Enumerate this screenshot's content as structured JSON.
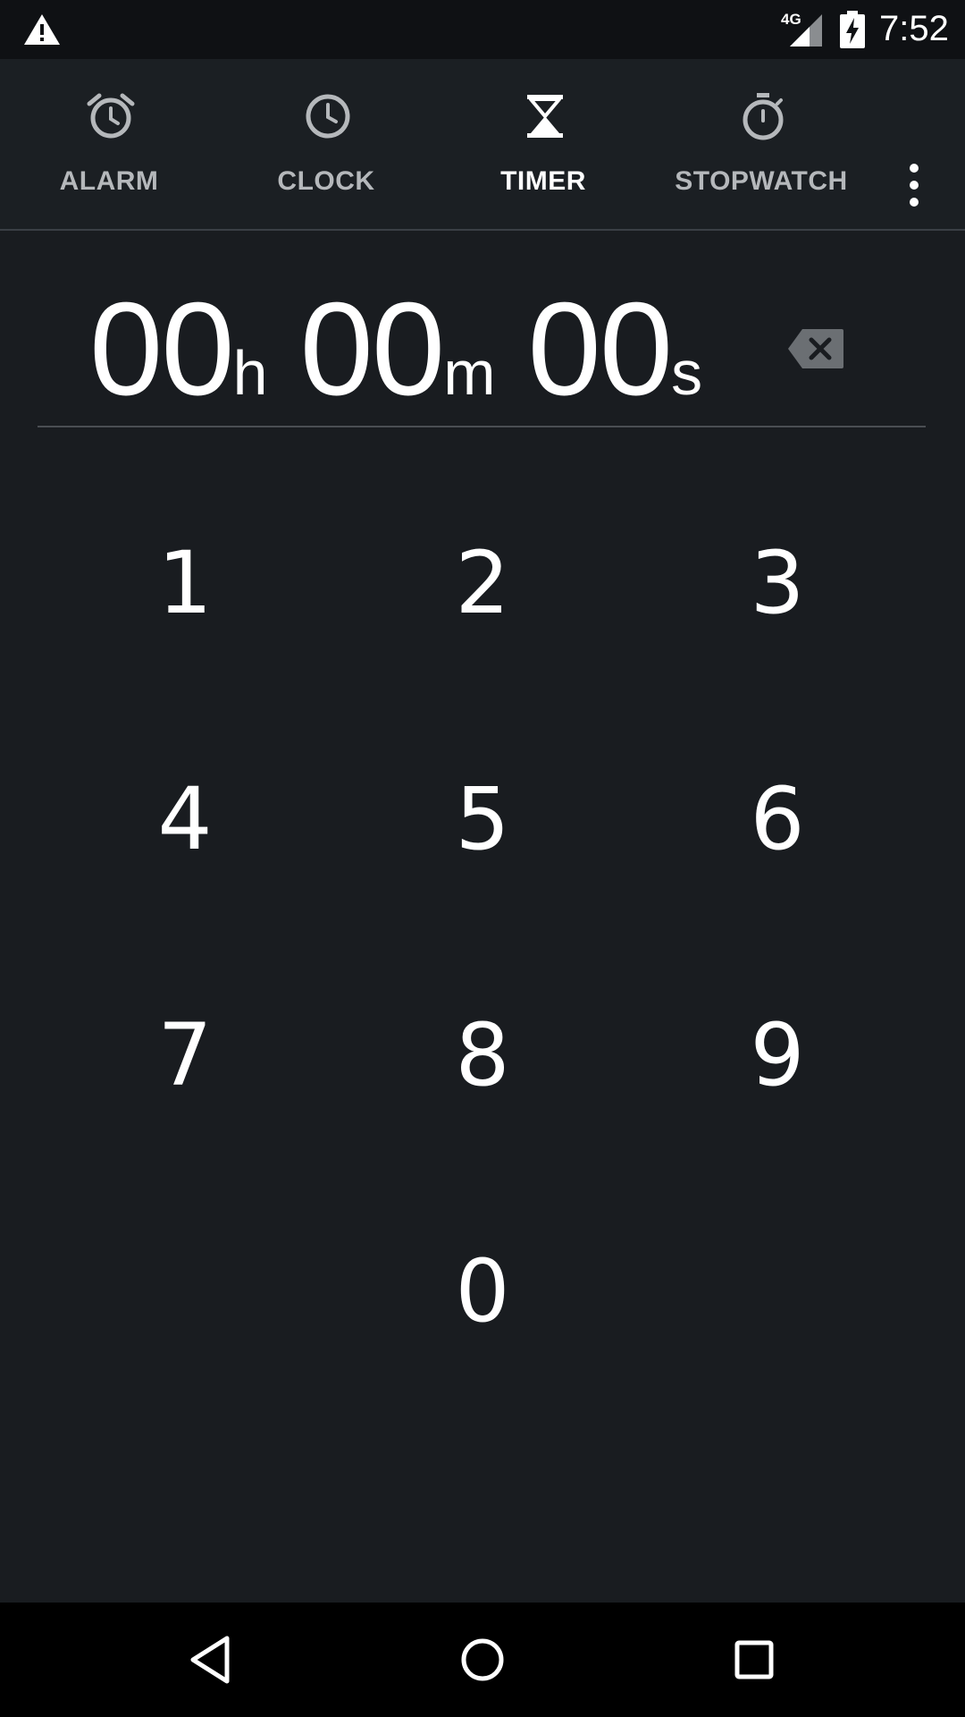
{
  "status_bar": {
    "network": "4G",
    "time": "7:52"
  },
  "tabs": [
    {
      "label": "ALARM",
      "icon": "alarm-clock-icon",
      "active": false
    },
    {
      "label": "CLOCK",
      "icon": "clock-icon",
      "active": false
    },
    {
      "label": "TIMER",
      "icon": "hourglass-icon",
      "active": true
    },
    {
      "label": "STOPWATCH",
      "icon": "stopwatch-icon",
      "active": false
    }
  ],
  "timer_display": {
    "hours": "00",
    "hours_unit": "h",
    "minutes": "00",
    "minutes_unit": "m",
    "seconds": "00",
    "seconds_unit": "s"
  },
  "keypad": {
    "keys": [
      "1",
      "2",
      "3",
      "4",
      "5",
      "6",
      "7",
      "8",
      "9",
      "0"
    ]
  },
  "colors": {
    "background": "#191c20",
    "tab_bar": "#1b1f23",
    "inactive_tab": "#b5b8bb",
    "text": "#ffffff"
  }
}
